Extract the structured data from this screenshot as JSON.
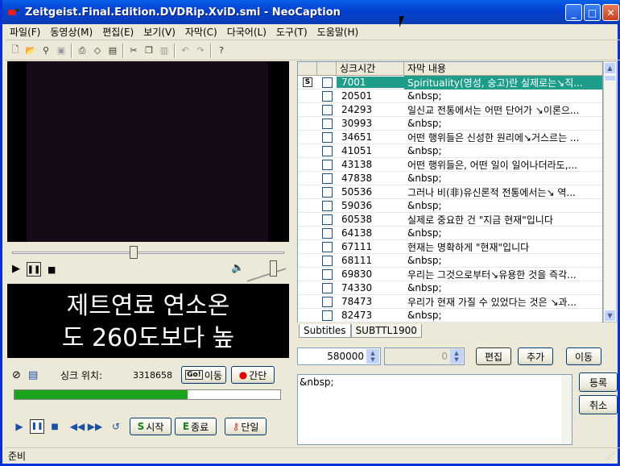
{
  "window": {
    "title": "Zeitgeist.Final.Edition.DVDRip.XviD.smi - NeoCaption",
    "min": "_",
    "max": "□",
    "close": "✕"
  },
  "menu": [
    "파일(F)",
    "동영상(M)",
    "편집(E)",
    "보기(V)",
    "자막(C)",
    "다국어(L)",
    "도구(T)",
    "도움말(H)"
  ],
  "toolbar_icons": [
    "new-file-icon",
    "open-folder-icon",
    "binoculars-icon",
    "save-icon",
    "print-preview-icon",
    "eraser-icon",
    "image-icon",
    "cut-icon",
    "copy-icon",
    "paste-icon",
    "undo-icon",
    "redo-icon",
    "help-icon"
  ],
  "player": {
    "subtitle_line1": "제트연료 연소온",
    "subtitle_line2": "도 260도보다 높",
    "sync_label": "싱크 위치:",
    "sync_value": "3318658",
    "go_button": "이동",
    "go_prefix": "Go!",
    "simple_button": "간단",
    "progress_fraction": 0.65,
    "start_button": "시작",
    "end_button": "종료",
    "single_button": "단일"
  },
  "table": {
    "headers": [
      "싱크시간",
      "자막 내용"
    ],
    "rows": [
      {
        "time": "7001",
        "text": "Spirituality(영성, 숭고)란 실제로는↘직...",
        "selected": true,
        "badge": "S"
      },
      {
        "time": "20501",
        "text": "&nbsp;"
      },
      {
        "time": "24293",
        "text": "일신교 전통에서는 어떤 단어가 ↘이론으..."
      },
      {
        "time": "30993",
        "text": "&nbsp;"
      },
      {
        "time": "34651",
        "text": "어떤 행위들은 신성한 원리에↘거스르는 ..."
      },
      {
        "time": "41051",
        "text": "&nbsp;"
      },
      {
        "time": "43138",
        "text": "어떤 행위들은, 어떤 일이 일어나더라도,..."
      },
      {
        "time": "47838",
        "text": "&nbsp;"
      },
      {
        "time": "50536",
        "text": "그러나 비(非)유신론적 전통에서는↘ 역..."
      },
      {
        "time": "59036",
        "text": "&nbsp;"
      },
      {
        "time": "60538",
        "text": "실제로 중요한 건 \"지금 현재\"입니다"
      },
      {
        "time": "64138",
        "text": "&nbsp;"
      },
      {
        "time": "67111",
        "text": "현재는 명확하게 \"현재\"입니다"
      },
      {
        "time": "68111",
        "text": "&nbsp;"
      },
      {
        "time": "69830",
        "text": "우리는 그것으로부터↘유용한 것을 즉각..."
      },
      {
        "time": "74330",
        "text": "&nbsp;"
      },
      {
        "time": "78473",
        "text": "우리가 현재 가질 수 있었다는 것은 ↘과..."
      },
      {
        "time": "82473",
        "text": "&nbsp;"
      }
    ]
  },
  "tabs": [
    "Subtitles",
    "SUBTTL1900"
  ],
  "editor": {
    "time_value": "580000",
    "second_value": "0",
    "edit_button": "편집",
    "add_button": "추가",
    "move_button": "이동",
    "text": "&nbsp;",
    "register_button": "등록",
    "cancel_button": "취소"
  },
  "status": {
    "text": "준비"
  },
  "colors": {
    "selection": "#1e9e8a",
    "progress": "#1ba31b",
    "titlebar": "#0343d1"
  }
}
